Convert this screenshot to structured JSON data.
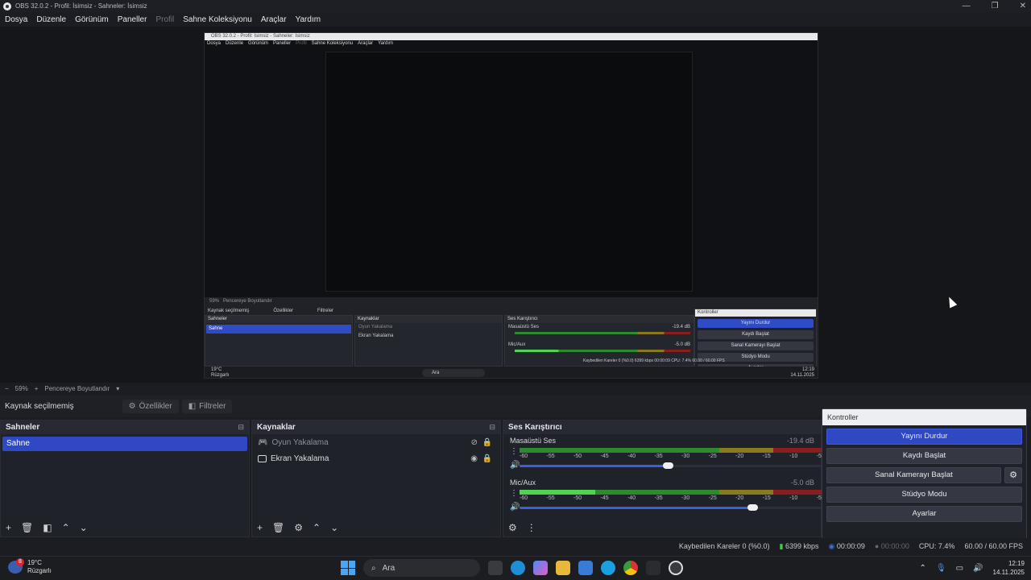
{
  "window": {
    "title": "OBS 32.0.2 - Profil: İsimsiz - Sahneler: İsimsiz",
    "controls": [
      "—",
      "❐",
      "✕"
    ]
  },
  "menu": [
    "Dosya",
    "Düzenle",
    "Görünüm",
    "Paneller",
    "Profil",
    "Sahne Koleksiyonu",
    "Araçlar",
    "Yardım"
  ],
  "nested": {
    "title": "OBS 32.0.2 - Profil: İsimsiz - Sahneler: İsimsiz",
    "menu": [
      "Dosya",
      "Düzenle",
      "Görünüm",
      "Paneller",
      "Profil",
      "Sahne Koleksiyonu",
      "Araçlar",
      "Yardım"
    ],
    "zoom": "59%",
    "resize": "Pencereye Boyutlandır",
    "no_source": "Kaynak seçilmemiş",
    "props": "Özellikler",
    "filters": "Filtreler",
    "scenes_header": "Sahneler",
    "scene": "Sahne",
    "sources_header": "Kaynaklar",
    "sources": [
      "Oyun Yakalama",
      "Ekran Yakalama"
    ],
    "mixer_header": "Ses Karıştırıcı",
    "ch1": "Masaüstü Ses",
    "ch1_db": "-19.4 dB",
    "ch2": "Mic/Aux",
    "ch2_db": "-5.0 dB",
    "controls_header": "Kontroller",
    "controls": [
      "Yayını Durdur",
      "Kaydı Başlat",
      "Sanal Kamerayı Başlat",
      "Stüdyo Modu",
      "Ayarlar"
    ],
    "status": "Kaybedilen Kareler 0 (%0.0)   6399 kbps   00:00:09   CPU: 7.4%   60.00 / 60.00 FPS",
    "taskbar_time": "12:19",
    "taskbar_date": "14.11.2025",
    "search": "Ara",
    "weather_temp": "19°C",
    "weather_desc": "Rüzgarlı"
  },
  "preview": {
    "zoom": "59%",
    "resize_label": "Pencereye Boyutlandır"
  },
  "source_bar": {
    "no_source": "Kaynak seçilmemiş",
    "properties": "Özellikler",
    "filters": "Filtreler"
  },
  "scenes": {
    "header": "Sahneler",
    "items": [
      "Sahne"
    ]
  },
  "sources": {
    "header": "Kaynaklar",
    "items": [
      {
        "name": "Oyun Yakalama",
        "visible": false
      },
      {
        "name": "Ekran Yakalama",
        "visible": true
      }
    ]
  },
  "mixer": {
    "header": "Ses Karıştırıcı",
    "ticks": [
      "-60",
      "-55",
      "-50",
      "-45",
      "-40",
      "-35",
      "-30",
      "-25",
      "-20",
      "-15",
      "-10",
      "-5"
    ],
    "channels": [
      {
        "name": "Masaüstü Ses",
        "db": "-19.4 dB",
        "level": 0.0,
        "volume": 0.49
      },
      {
        "name": "Mic/Aux",
        "db": "-5.0 dB",
        "level": 0.25,
        "volume": 0.77
      }
    ]
  },
  "controls": {
    "header": "Kontroller",
    "stop_stream": "Yayını Durdur",
    "start_record": "Kaydı Başlat",
    "start_virtualcam": "Sanal Kamerayı Başlat",
    "studio_mode": "Stüdyo Modu",
    "settings": "Ayarlar"
  },
  "status": {
    "dropped": "Kaybedilen Kareler 0 (%0.0)",
    "bitrate": "6399 kbps",
    "stream_time": "00:00:09",
    "record_time": "00:00:00",
    "cpu": "CPU: 7.4%",
    "fps": "60.00 / 60.00 FPS"
  },
  "taskbar": {
    "weather_temp": "19°C",
    "weather_desc": "Rüzgarlı",
    "badge": "8",
    "search": "Ara",
    "time": "12:19",
    "date": "14.11.2025"
  },
  "colors": {
    "accent": "#2f49c4",
    "meter_green": "#4fd44f",
    "stream_active": "#3fce3f"
  }
}
